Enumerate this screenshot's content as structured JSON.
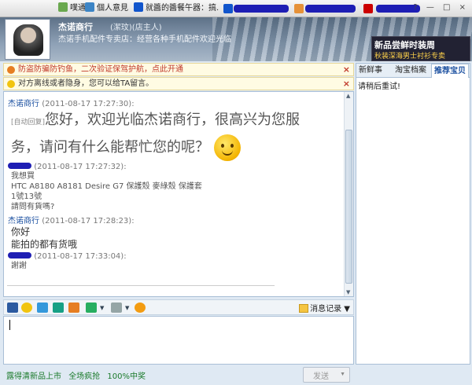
{
  "taskbar": {
    "tabs": [
      {
        "label": "噗通™"
      },
      {
        "label": "個人意見"
      },
      {
        "label": "就醬的醬餐午器：搞..."
      }
    ]
  },
  "header": {
    "shop_name": "杰诺商行",
    "shop_tag": "(潔玟)(店主人)",
    "signature": "杰诺手机配件专卖店：经营各种手机配件欢迎光临",
    "ad_line1": "新品尝鲜时装周",
    "ad_line2": "秋装深海男士衬衫专卖"
  },
  "notices": {
    "security": "防盗防骗防钓鱼，二次验证保驾护航，点此开通",
    "offline": "对方离线或者隐身，您可以给TA留言。",
    "close": "×"
  },
  "messages": {
    "m1": {
      "sender": "杰诺商行",
      "time": "(2011-08-17 17:27:30):",
      "auto": "[自动回复]",
      "line1": "您好，欢迎光临杰诺商行，很高兴为您服",
      "line2": "务，请问有什么能帮忙您的呢？"
    },
    "m2": {
      "time": "(2011-08-17 17:27:32):",
      "l1": "我想買",
      "l2": "HTC A8180 A8181 Desire G7 保護殼 麥綠殼 保護套",
      "l3": "1號13號",
      "l4": "請問有貨嗎?"
    },
    "m3": {
      "sender": "杰诺商行",
      "time": "(2011-08-17 17:28:23):",
      "l1": "你好",
      "l2": "能拍的都有货哦"
    },
    "m4": {
      "time": "(2011-08-17 17:33:04):",
      "l1": "謝謝"
    }
  },
  "input_toolbar": {
    "history_label": "消息记录"
  },
  "footer": {
    "promo1": "露得清新品上市",
    "promo2": "全场疯抢",
    "promo3": "100%中奖",
    "send_label": "发送"
  },
  "right_panel": {
    "tabs": [
      "新鲜事",
      "淘宝档案",
      "推荐宝贝"
    ],
    "content": "请稍后重试!"
  },
  "colors": {
    "accent": "#1a4fa0",
    "warning": "#c0392b",
    "redaction": "#1e1eb4"
  }
}
